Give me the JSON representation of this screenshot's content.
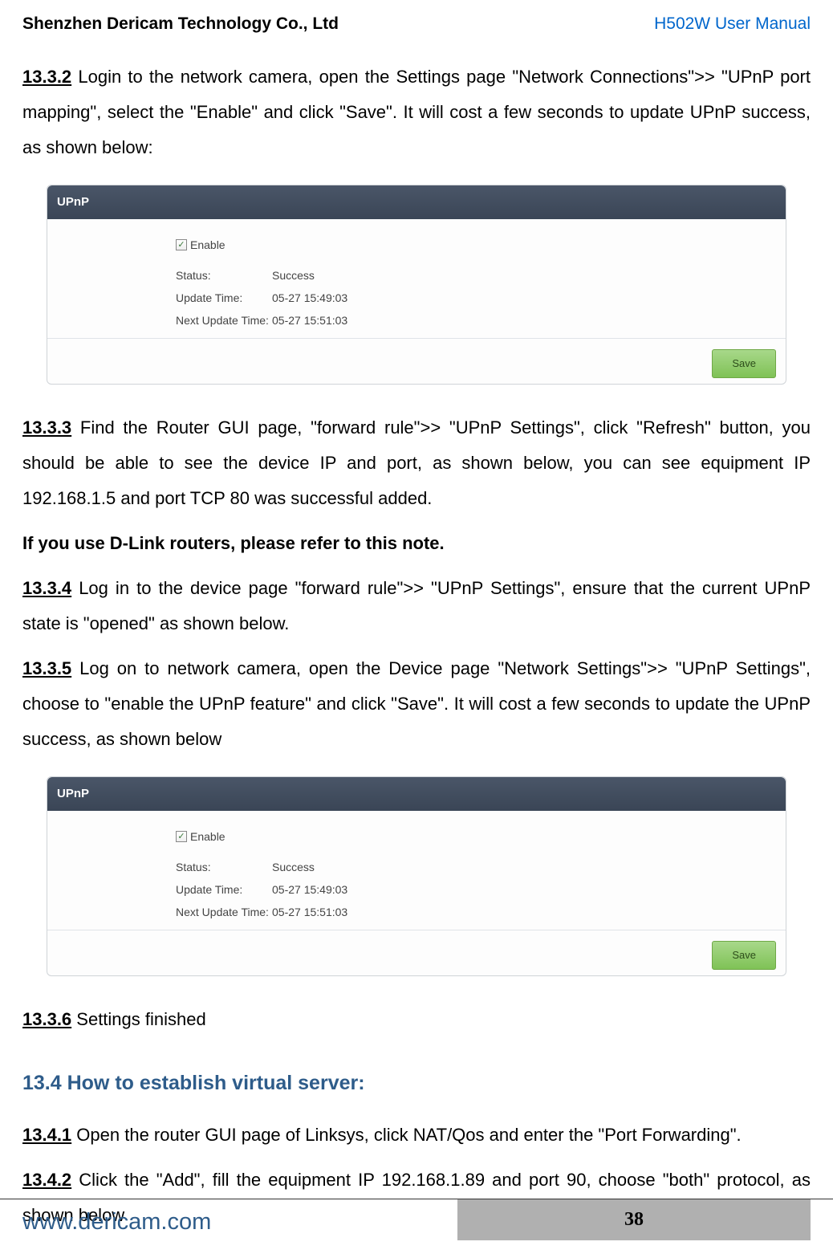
{
  "header": {
    "company": "Shenzhen Dericam Technology Co., Ltd",
    "manual": "H502W User Manual"
  },
  "body": {
    "p1_num": "13.3.2",
    "p1_text": " Login to the network camera, open the Settings page \"Network Connections\">> \"UPnP port mapping\", select the \"Enable\" and click \"Save\". It will cost a few seconds to update UPnP success, as shown below:",
    "p2_num": "13.3.3",
    "p2_text": " Find the Router GUI page, \"forward rule\">> \"UPnP Settings\", click \"Refresh\" button, you should be able to see the device IP and port, as shown below, you can see equipment IP 192.168.1.5 and port TCP 80 was successful added.",
    "bold_note": "If you use D-Link routers, please refer to this note.",
    "p3_num": "13.3.4",
    "p3_text": " Log in to the device page \"forward rule\">> \"UPnP Settings\", ensure that the current UPnP state is \"opened\" as shown below.",
    "p4_num": "13.3.5",
    "p4_text": " Log on to network camera, open the Device page \"Network Settings\">> \"UPnP Settings\", choose to \"enable the UPnP feature\" and click \"Save\". It will cost a few seconds to update the UPnP success, as shown below",
    "p5_num": "13.3.6",
    "p5_text": " Settings finished",
    "heading_134": "13.4 How to establish virtual server:",
    "p6_num": "13.4.1",
    "p6_text": " Open the router GUI page of Linksys, click NAT/Qos and enter the \"Port Forwarding\".",
    "p7_num": "13.4.2",
    "p7_text": " Click the \"Add\", fill the equipment IP 192.168.1.89 and port 90, choose \"both\" protocol, as shown below"
  },
  "panel": {
    "title": "UPnP",
    "enable": "Enable",
    "status_label": "Status:",
    "status_value": "Success",
    "update_label": "Update Time:",
    "update_value": "05-27 15:49:03",
    "next_label": "Next Update Time:",
    "next_value": "05-27 15:51:03",
    "save": "Save"
  },
  "footer": {
    "url": "www.dericam.com",
    "page": "38"
  }
}
